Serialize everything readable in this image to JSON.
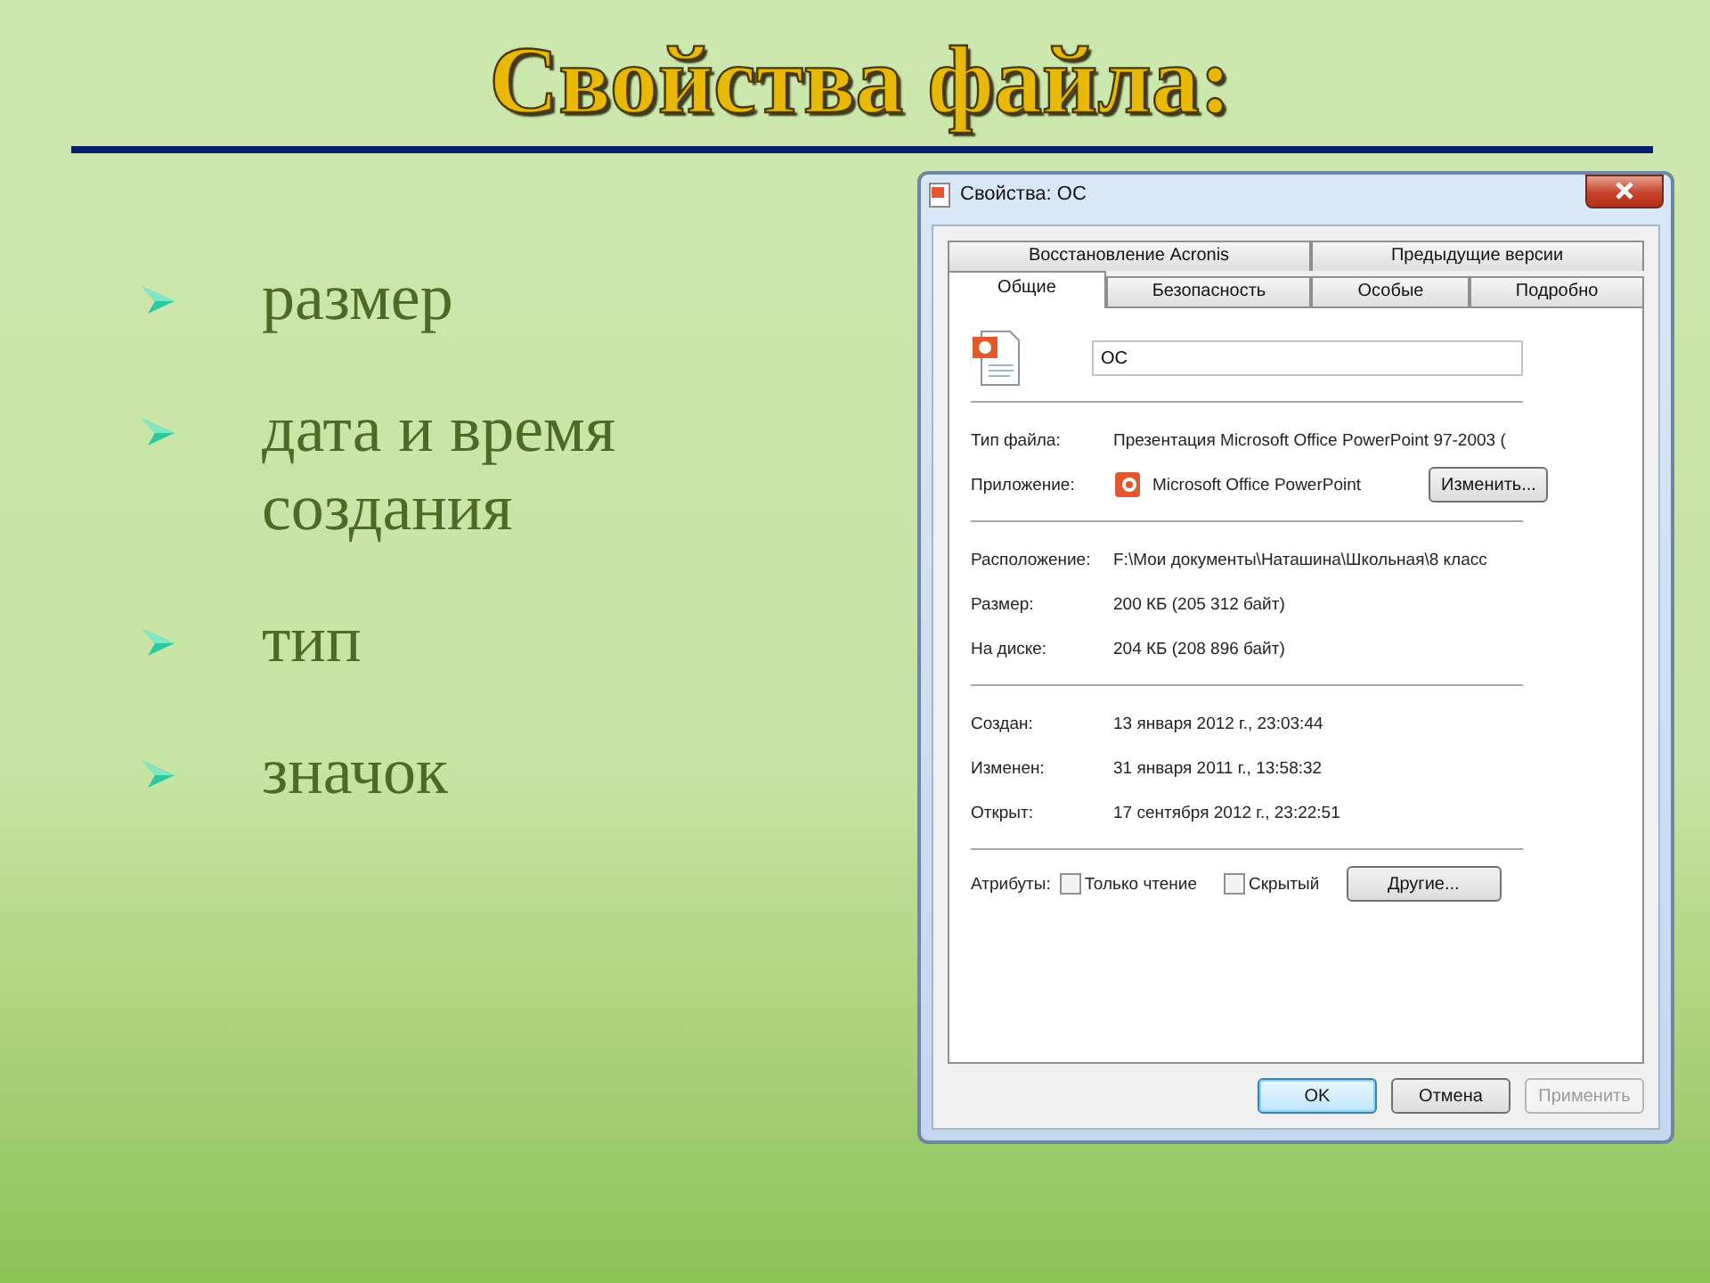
{
  "slide_title": "Свойства файла:",
  "bullets": [
    "размер",
    "дата и время создания",
    "тип",
    "значок"
  ],
  "dialog": {
    "title": "Свойства: ОС",
    "tab_rows": [
      [
        {
          "label": "Восстановление Acronis",
          "selected": false
        },
        {
          "label": "Предыдущие версии",
          "selected": false
        }
      ],
      [
        {
          "label": "Общие",
          "selected": true
        },
        {
          "label": "Безопасность",
          "selected": false
        },
        {
          "label": "Особые",
          "selected": false
        },
        {
          "label": "Подробно",
          "selected": false
        }
      ]
    ],
    "name_field": {
      "value": "ОС"
    },
    "sections": [
      [
        {
          "kind": "text",
          "label": "Тип файла:",
          "value": "Презентация Microsoft Office PowerPoint 97-2003 ("
        },
        {
          "kind": "app",
          "label": "Приложение:",
          "value": "Microsoft Office PowerPoint",
          "button": "Изменить..."
        }
      ],
      [
        {
          "kind": "text",
          "label": "Расположение:",
          "value": "F:\\Мои документы\\Наташина\\Школьная\\8 класс"
        },
        {
          "kind": "text",
          "label": "Размер:",
          "value": "200 КБ (205 312 байт)"
        },
        {
          "kind": "text",
          "label": "На диске:",
          "value": "204 КБ (208 896 байт)"
        }
      ],
      [
        {
          "kind": "text",
          "label": "Создан:",
          "value": "13 января 2012 г., 23:03:44"
        },
        {
          "kind": "text",
          "label": "Изменен:",
          "value": "31 января 2011 г., 13:58:32"
        },
        {
          "kind": "text",
          "label": "Открыт:",
          "value": "17 сентября 2012 г., 23:22:51"
        }
      ]
    ],
    "attributes": {
      "label": "Атрибуты:",
      "checkboxes": [
        {
          "label": "Только чтение",
          "checked": false
        },
        {
          "label": "Скрытый",
          "checked": false
        }
      ],
      "button": "Другие..."
    },
    "buttons": [
      {
        "label": "OK",
        "default": true,
        "disabled": false
      },
      {
        "label": "Отмена",
        "default": false,
        "disabled": false
      },
      {
        "label": "Применить",
        "default": false,
        "disabled": true
      }
    ]
  }
}
